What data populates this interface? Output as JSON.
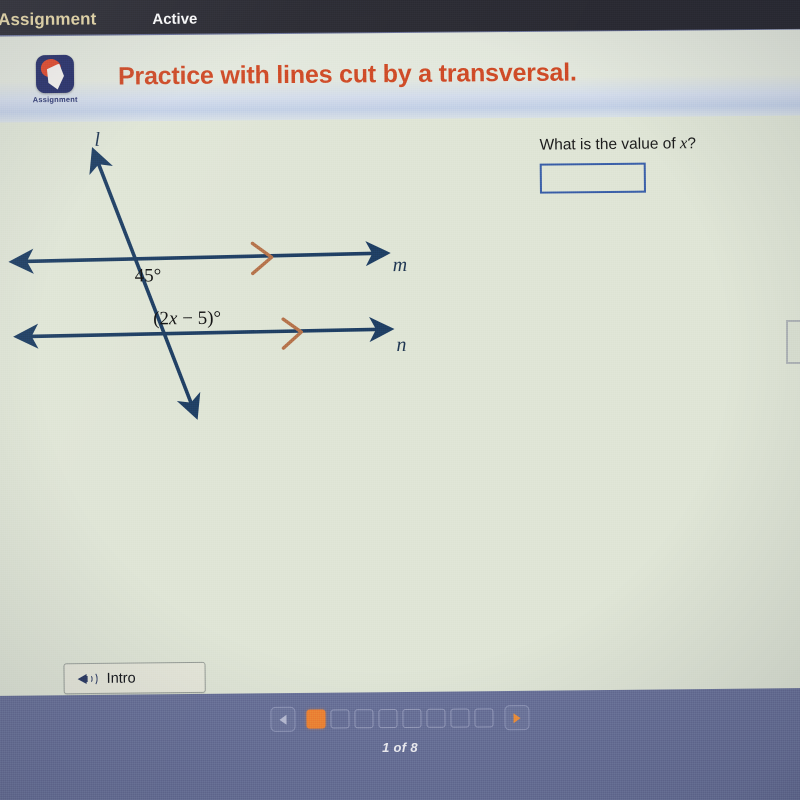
{
  "topbar": {
    "assignment_label": "Assignment",
    "status_label": "Active"
  },
  "header": {
    "icon_caption": "Assignment",
    "title": "Practice with lines cut by a transversal.",
    "title_color": "#cf4a26",
    "icon_colors": {
      "background": "#27306a",
      "accent": "#e0492c"
    }
  },
  "question": {
    "prompt_prefix": "What is the value of ",
    "prompt_variable": "x",
    "prompt_suffix": "?",
    "answer_value": "",
    "answer_placeholder": "",
    "border_color": "#3a5fa8"
  },
  "figure": {
    "line_labels": {
      "transversal": "l",
      "upper_parallel": "m",
      "lower_parallel": "n"
    },
    "angles": [
      {
        "text": "45°",
        "line": "m"
      },
      {
        "text_before": "(2",
        "text_var": "x",
        "text_after": " − 5)°",
        "line": "n"
      }
    ],
    "line_color": "#1e3e63",
    "tick_color": "#b5724a"
  },
  "toolbar": {
    "intro_label": "Intro",
    "speaker_icon": "speaker-icon"
  },
  "pager": {
    "prev_icon": "chevron-left-icon",
    "next_icon": "chevron-right-icon",
    "total_steps": 8,
    "current_step": 1,
    "count_label": "1 of 8",
    "active_color": "#f08434"
  }
}
